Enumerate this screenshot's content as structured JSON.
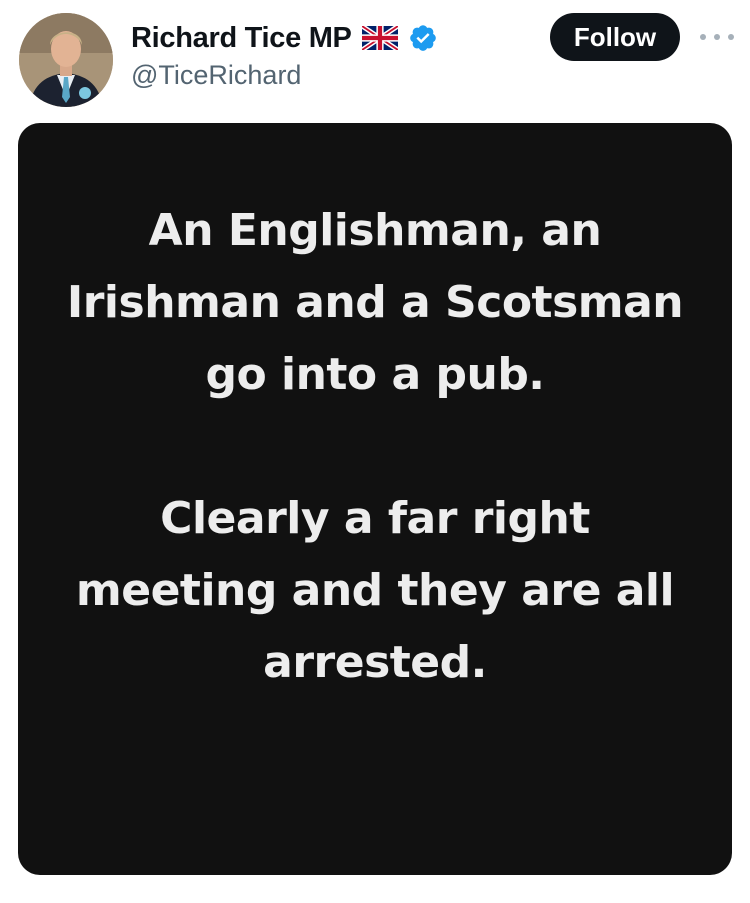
{
  "post": {
    "author": {
      "display_name": "Richard Tice MP",
      "handle": "@TiceRichard",
      "flag_icon": "uk-flag-icon",
      "verified_icon": "verified-badge-icon",
      "verified_color": "#1d9bf0"
    },
    "actions": {
      "follow_label": "Follow",
      "more_icon": "more-options-icon"
    },
    "media": {
      "paragraph_1": "An Englishman, an Irishman and a Scotsman go into a pub.",
      "paragraph_2": "Clearly a far right meeting and they are all arrested.",
      "background_color": "#111111",
      "text_color": "#ededed"
    }
  }
}
